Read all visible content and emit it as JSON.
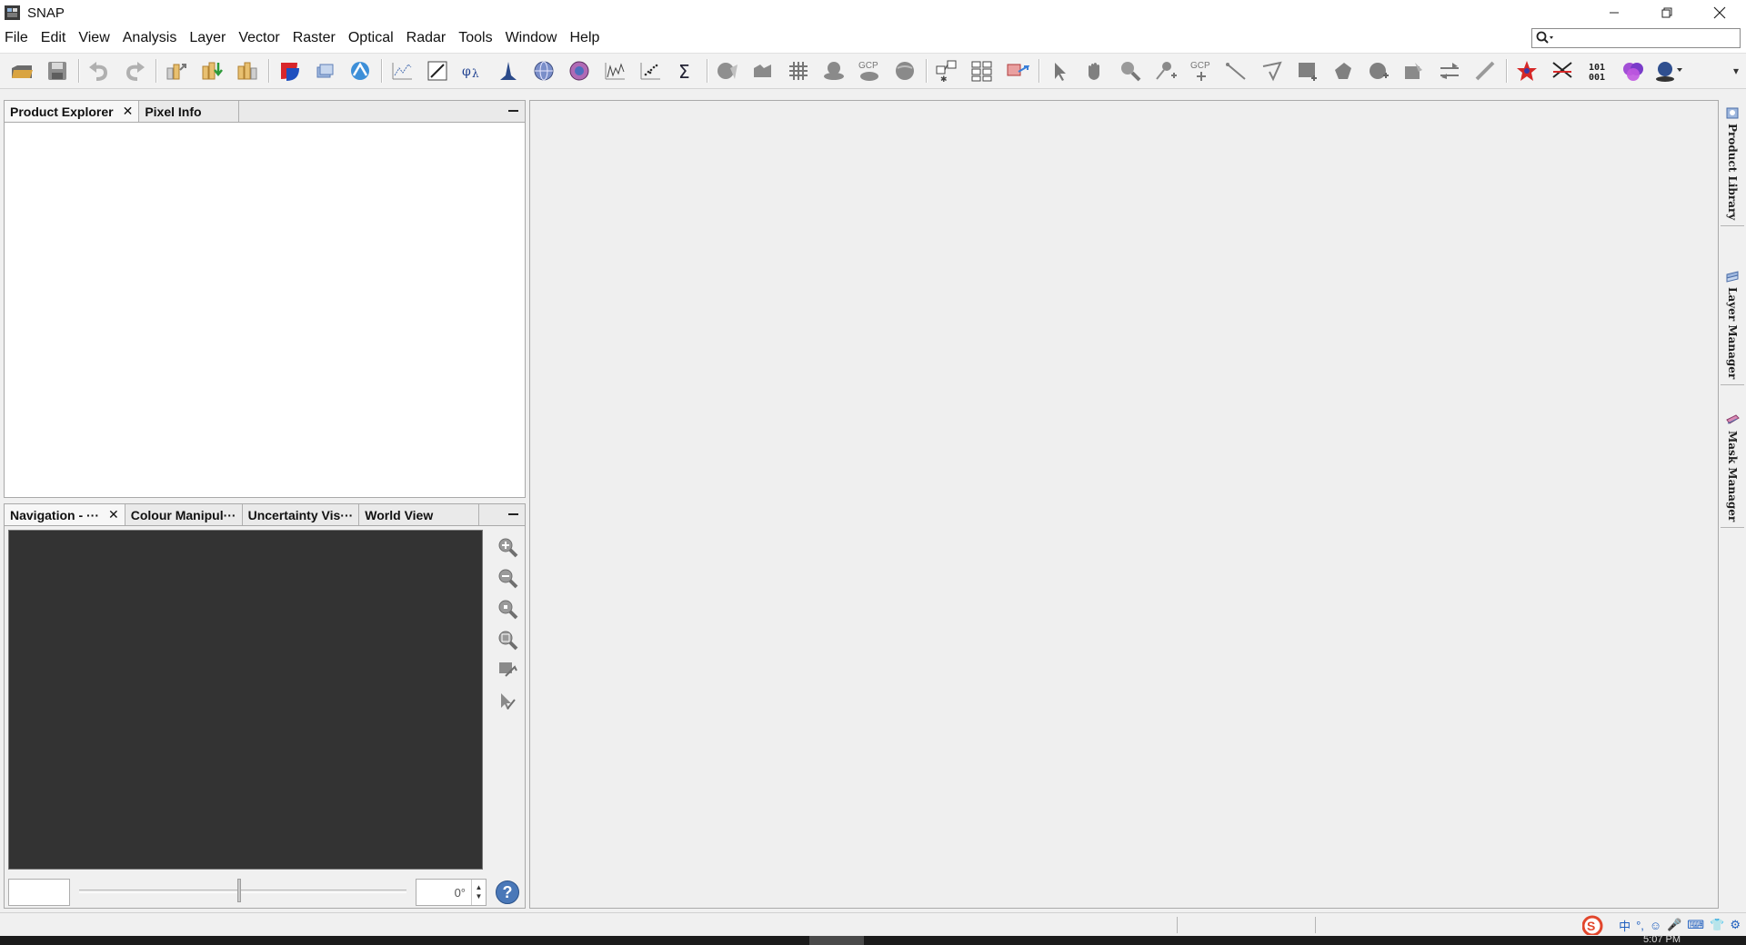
{
  "window": {
    "title": "SNAP",
    "controls": [
      "minimize",
      "restore",
      "close"
    ]
  },
  "menubar": {
    "items": [
      "File",
      "Edit",
      "View",
      "Analysis",
      "Layer",
      "Vector",
      "Raster",
      "Optical",
      "Radar",
      "Tools",
      "Window",
      "Help"
    ]
  },
  "search": {
    "placeholder": "",
    "icon": "search-icon"
  },
  "toolbar": {
    "groups": [
      [
        "open-product-icon",
        "save-product-icon"
      ],
      [
        "undo-icon",
        "redo-icon"
      ],
      [
        "export-icon",
        "import-icon",
        "band-subset-icon"
      ],
      [
        "rgb-image-icon",
        "band-maths-icon",
        "pixel-explorer-icon"
      ],
      [
        "profile-plot-icon",
        "draw-line-icon",
        "spectrum-icon",
        "histogram-icon",
        "geocoding-icon",
        "information-icon",
        "time-series-icon",
        "scatter-plot-icon",
        "statistics-icon"
      ],
      [
        "graph-builder-icon",
        "batch-processing-icon",
        "grid-icon",
        "map-projection-icon",
        "gcp-icon",
        "world-map-icon"
      ],
      [
        "tie-point-icon",
        "stack-icon",
        "reprojection-icon"
      ],
      [
        "select-tool-icon",
        "pan-tool-icon",
        "zoom-tool-icon",
        "pin-placing-icon",
        "gcp-placing-icon",
        "line-drawing-icon",
        "polyline-drawing-icon",
        "rectangle-drawing-icon",
        "ellipse-drawing-icon",
        "polygon-drawing-icon",
        "magic-wand-icon",
        "range-finder-icon",
        "ruler-icon"
      ],
      [
        "star-icon",
        "cross-icon",
        "binary-icon",
        "shapes-icon",
        "globe-icon"
      ]
    ],
    "gcp_label": "GCP"
  },
  "product_explorer_panel": {
    "tabs": [
      {
        "label": "Product Explorer",
        "closable": true,
        "active": true
      },
      {
        "label": "Pixel Info",
        "closable": false,
        "active": false
      }
    ]
  },
  "navigation_panel": {
    "tabs": [
      {
        "label": "Navigation - ···",
        "closable": true,
        "active": true
      },
      {
        "label": "Colour Manipul···",
        "closable": false,
        "active": false
      },
      {
        "label": "Uncertainty Vis···",
        "closable": false,
        "active": false
      },
      {
        "label": "World View",
        "closable": false,
        "active": false
      }
    ],
    "tools": [
      "zoom-in-icon",
      "zoom-out-icon",
      "zoom-pixel-icon",
      "zoom-all-icon",
      "sync-views-icon",
      "sync-cursor-icon"
    ],
    "rotation_value": "0°",
    "help_label": "?"
  },
  "right_sidebar": {
    "tabs": [
      "Product Library",
      "Layer Manager",
      "Mask Manager"
    ]
  },
  "tray": {
    "items": [
      "中",
      "°,",
      "☺",
      "🎤",
      "⌨",
      "👕",
      "⚙"
    ]
  },
  "clock": "5:07 PM"
}
